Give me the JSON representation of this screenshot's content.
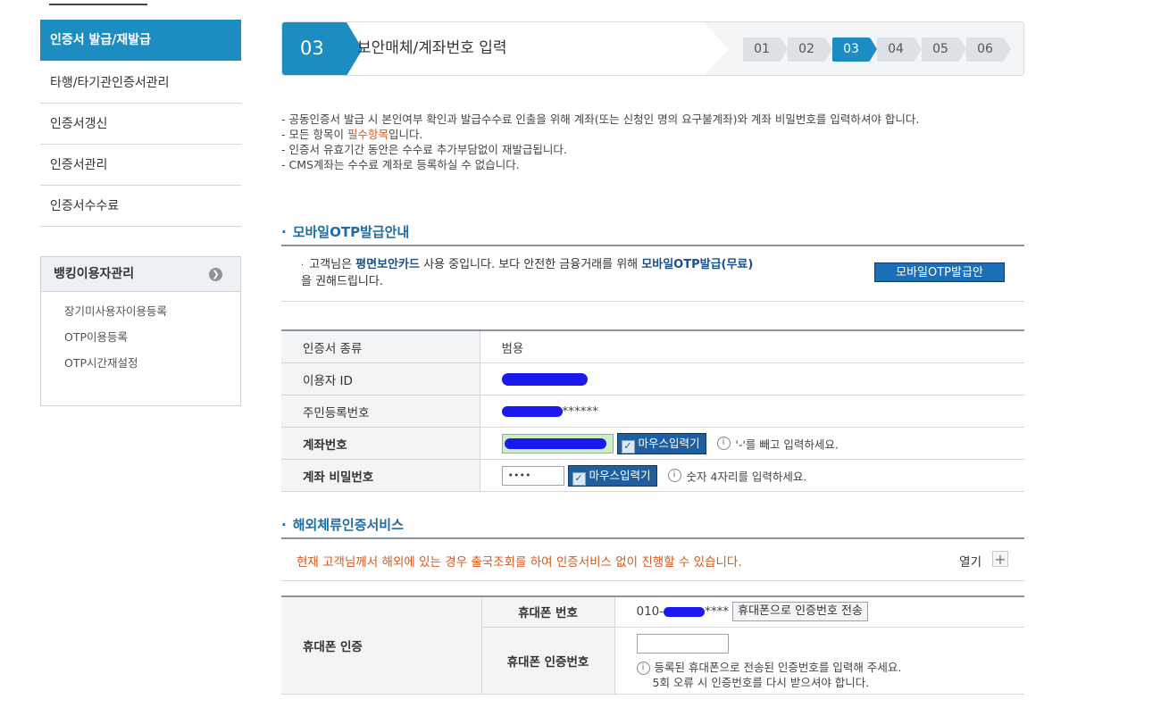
{
  "sidebar": {
    "items": [
      {
        "label": "인증서 발급/재발급",
        "active": true
      },
      {
        "label": "타행/타기관인증서관리"
      },
      {
        "label": "인증서갱신"
      },
      {
        "label": "인증서관리"
      },
      {
        "label": "인증서수수료"
      }
    ],
    "bank_menu": {
      "title": "뱅킹이용자관리",
      "icon": "chevron-right-circle-icon",
      "items": [
        "장기미사용자이용등록",
        "OTP이용등록",
        "OTP시간재설정"
      ]
    }
  },
  "step_header": {
    "current_num": "03",
    "title": "보안매체/계좌번호 입력",
    "steps": [
      "01",
      "02",
      "03",
      "04",
      "05",
      "06"
    ],
    "current_index": 2
  },
  "notes": [
    "- 공동인증서 발급 시 본인여부 확인과 발급수수료 인출을 위해 계좌(또는 신청인 명의 요구불계좌)와 계좌 비밀번호를 입력하셔야 합니다.",
    {
      "pre": "- 모든 항목이 ",
      "red": "필수항목",
      "post": "입니다."
    },
    "- 인증서 유효기간 동안은 수수료 추가부담없이 재발급됩니다.",
    "- CMS계좌는 수수료 계좌로 등록하실 수 없습니다."
  ],
  "otp_section": {
    "title": "모바일OTP발급안내",
    "text_pre": "고객님은 ",
    "text_bold1": "평면보안카드",
    "text_mid": " 사용 중입니다. 보다 안전한 금융거래를 위해 ",
    "text_bold2": "모바일OTP발급(무료)",
    "text_post": "을 권해드립니다.",
    "button_label": "모바일OTP발급안"
  },
  "form": {
    "cert_type_label": "인증서 종류",
    "cert_type_value": "범용",
    "user_id_label": "이용자 ID",
    "rrn_label": "주민등록번호",
    "rrn_suffix": "******",
    "account_label": "계좌번호",
    "mouse_input_label": "마우스입력기",
    "account_hint": "'-'를 빼고 입력하세요.",
    "password_label": "계좌 비밀번호",
    "password_value": "••••",
    "password_hint": "숫자 4자리를 입력하세요."
  },
  "overseas": {
    "title": "해외체류인증서비스",
    "message": "현재 고객님께서 해외에 있는 경우 출국조회를 하여 인증서비스 없이 진행할 수 있습니다.",
    "open_label": "열기",
    "plus_symbol": "+"
  },
  "phone_auth": {
    "main_label": "휴대폰 인증",
    "phone_number_label": "휴대폰 번호",
    "phone_prefix": "010-",
    "phone_suffix": "****",
    "send_button": "휴대폰으로 인증번호 전송",
    "code_label": "휴대폰 인증번호",
    "code_hint_1": "등록된 휴대폰으로 전송된 인증번호를 입력해 주세요.",
    "code_hint_2": "5회 오류 시 인증번호를 다시 받으셔야 합니다."
  },
  "colors": {
    "accent": "#1c8cc1",
    "section_title": "#1c6da1",
    "warning": "#d35a1e",
    "button_dark": "#1f5f9e"
  }
}
